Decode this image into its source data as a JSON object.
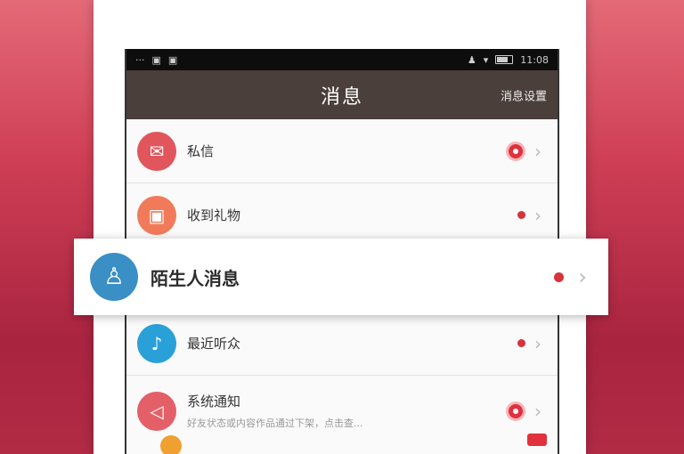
{
  "status_bar": {
    "left_icons": [
      "···",
      "▣",
      "▣"
    ],
    "right_icons": [
      "♟",
      "▾"
    ],
    "time": "11:08"
  },
  "nav": {
    "title": "消息",
    "action": "消息设置"
  },
  "rows": [
    {
      "label": "私信",
      "sub": "",
      "icon": "mail-icon",
      "glyph": "✉",
      "color": "#e0565c",
      "indicator": "badge"
    },
    {
      "label": "收到礼物",
      "sub": "",
      "icon": "gift-icon",
      "glyph": "▣",
      "color": "#f07a5a",
      "indicator": "dot"
    },
    {
      "label": "陌生人消息",
      "sub": "",
      "icon": "person-icon",
      "glyph": "♙",
      "color": "#3a8fc4",
      "indicator": "dot"
    },
    {
      "label": "最近听众",
      "sub": "",
      "icon": "audience-icon",
      "glyph": "♪",
      "color": "#2aa0d8",
      "indicator": "dot"
    },
    {
      "label": "系统通知",
      "sub": "好友状态或内容作品通过下架，点击查...",
      "icon": "megaphone-icon",
      "glyph": "◁",
      "color": "#e46068",
      "indicator": "badge"
    }
  ],
  "colors": {
    "nav_bg": "#4a3f3a",
    "accent_red": "#d8323c"
  }
}
